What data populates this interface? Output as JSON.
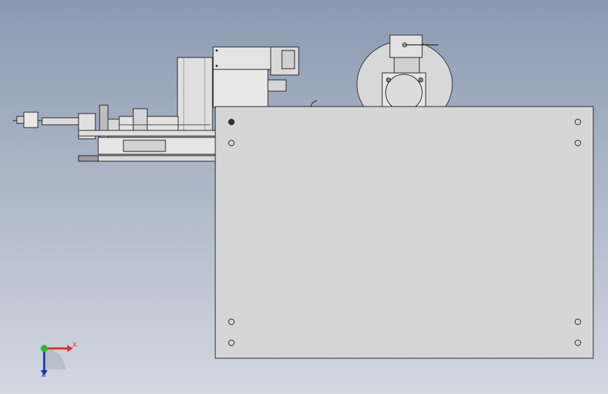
{
  "viewport": {
    "background_top": "#8b9ab2",
    "background_bottom": "#d3d8e1"
  },
  "triad": {
    "x_label": "X",
    "z_label": "Z",
    "x_color": "#e03020",
    "y_color": "#20c020",
    "z_color": "#2233aa"
  }
}
